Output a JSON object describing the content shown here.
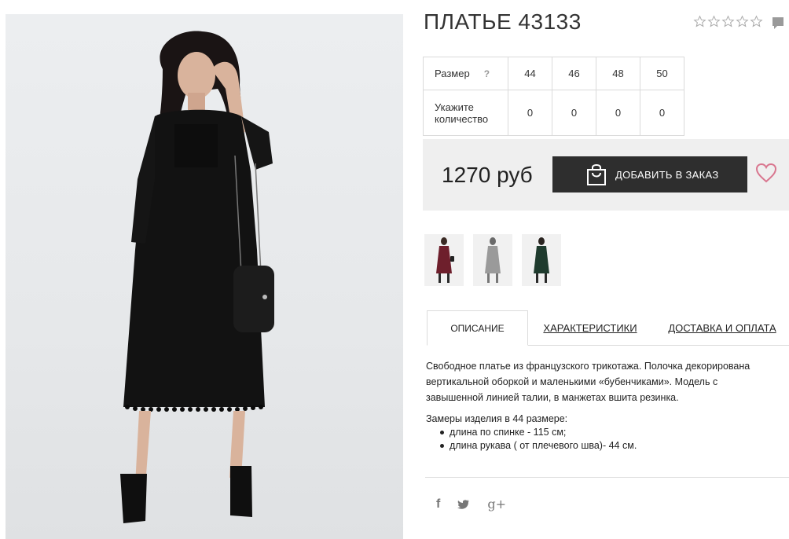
{
  "product": {
    "title": "ПЛАТЬЕ 43133",
    "rating": 0,
    "rating_max": 5,
    "price": "1270 руб"
  },
  "sizes_table": {
    "size_label": "Размер",
    "help_mark": "?",
    "qty_label_line1": "Укажите",
    "qty_label_line2": "количество",
    "sizes": [
      "44",
      "46",
      "48",
      "50"
    ],
    "quantities": [
      "0",
      "0",
      "0",
      "0"
    ]
  },
  "buy": {
    "add_button_label": "ДОБАВИТЬ В ЗАКАЗ",
    "bag_icon": "shopping-bag-icon",
    "wishlist_icon": "heart-icon"
  },
  "thumbnails": [
    {
      "name": "thumb-burgundy",
      "color": "#6e1f2c"
    },
    {
      "name": "thumb-grey",
      "color": "#8c8c8c"
    },
    {
      "name": "thumb-green",
      "color": "#1f3b2e"
    }
  ],
  "tabs": [
    {
      "label": "ОПИСАНИЕ",
      "active": true
    },
    {
      "label": "ХАРАКТЕРИСТИКИ",
      "active": false
    },
    {
      "label": "ДОСТАВКА И ОПЛАТА",
      "active": false
    }
  ],
  "description": {
    "text": "Свободное платье из французского трикотажа. Полочка декорирована вертикальной оборкой и маленькими «бубенчиками». Модель с завышенной линией талии, в манжетах вшита резинка.",
    "measurements_title": "Замеры изделия в 44 размере:",
    "measurements": [
      "длина по спинке - 115 см;",
      "длина рукава ( от плечевого шва)- 44 см."
    ]
  },
  "social": {
    "facebook": "f",
    "twitter_icon": "twitter-icon",
    "googleplus": "g+"
  },
  "colors": {
    "button_bg": "#2e2e2e",
    "heart": "#d9768f",
    "buybox_bg": "#efefef"
  }
}
